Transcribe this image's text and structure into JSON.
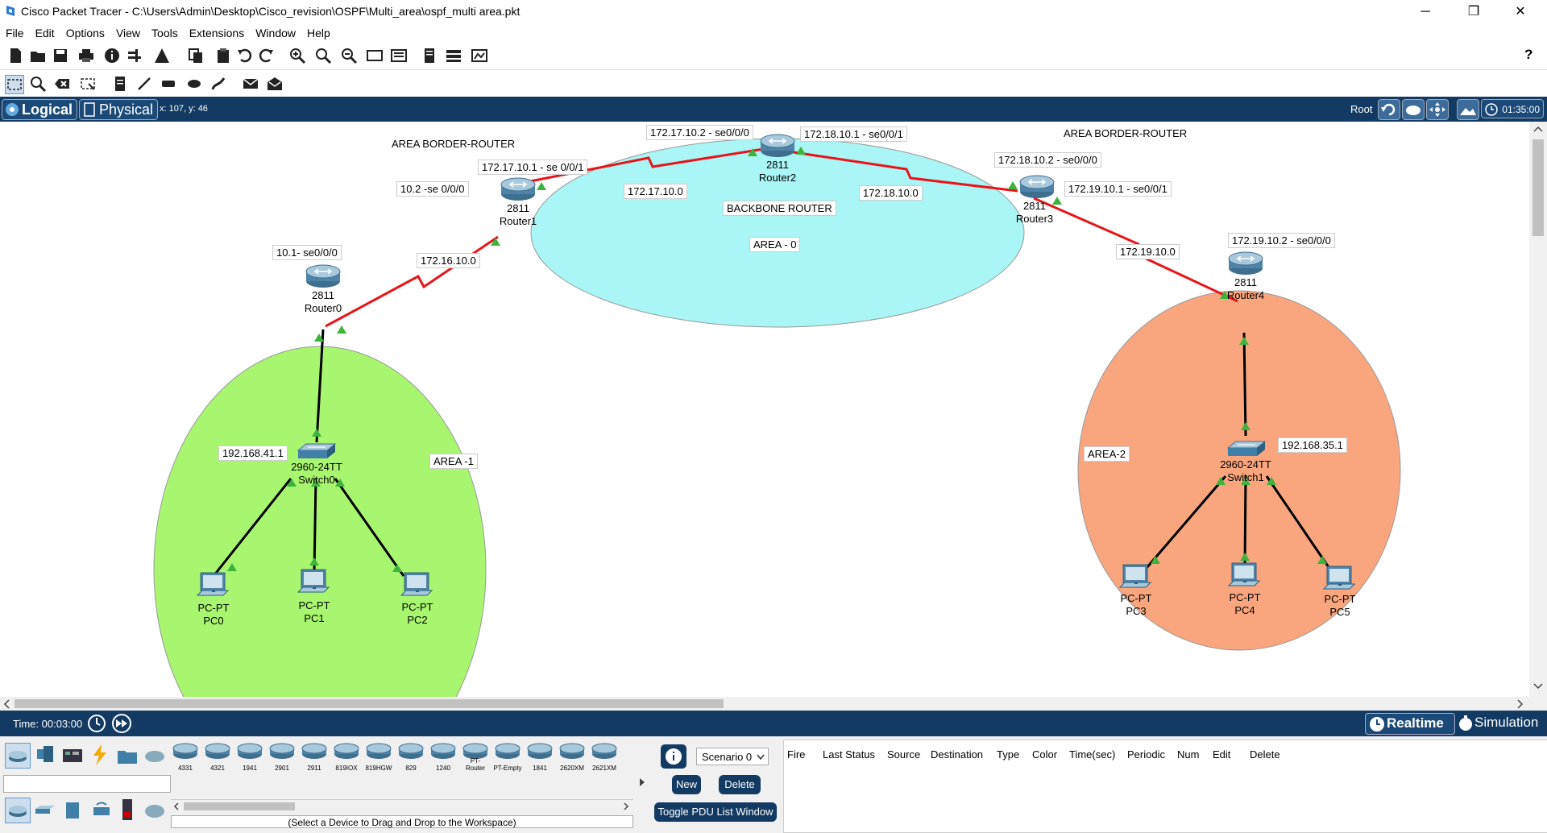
{
  "window": {
    "title": "Cisco Packet Tracer - C:\\Users\\Admin\\Desktop\\Cisco_revision\\OSPF\\Multi_area\\ospf_multi area.pkt",
    "minimize": "─",
    "restore": "❐",
    "close": "✕"
  },
  "menu": [
    "File",
    "Edit",
    "Options",
    "View",
    "Tools",
    "Extensions",
    "Window",
    "Help"
  ],
  "toolbar": {
    "help": "?",
    "main_icons": [
      "new-icon",
      "open-icon",
      "save-icon",
      "print-icon",
      "info-icon",
      "wizard-icon",
      "activity-icon",
      "copy-icon",
      "paste-icon",
      "undo-icon",
      "redo-icon",
      "zoom-in-icon",
      "zoom-reset-icon",
      "zoom-out-icon",
      "drawing-palette-icon",
      "custom-devices-icon",
      "notes-icon",
      "cluster-icon",
      "viewport-icon"
    ],
    "tool_icons": [
      "select-icon",
      "inspect-icon",
      "delete-icon",
      "resize-icon",
      "note-icon",
      "line-icon",
      "rectangle-icon",
      "ellipse-icon",
      "freeform-icon",
      "simple-pdu-icon",
      "complex-pdu-icon"
    ]
  },
  "modebar": {
    "logical": "Logical",
    "physical": "Physical",
    "coords": "x: 107, y: 46",
    "root": "Root",
    "time": "01:35:00"
  },
  "topology": {
    "areas": {
      "backbone": {
        "label": "AREA - 0",
        "sublabel": "BACKBONE ROUTER",
        "color": "#aaf5f5"
      },
      "area1": {
        "label": "AREA -1",
        "color": "#a8f56f"
      },
      "area2": {
        "label": "AREA-2",
        "color": "#f9a67e"
      }
    },
    "annotations": {
      "abr_left": "AREA BORDER-ROUTER",
      "abr_right": "AREA BORDER-ROUTER",
      "r2_left_if": "172.17.10.2 - se0/0/0",
      "r2_right_if": "172.18.10.1 - se0/0/1",
      "r1_right_if": "172.17.10.1 - se 0/0/1",
      "r1_left_if": "10.2 -se 0/0/0",
      "r0_if": "10.1- se0/0/0",
      "net_17": "172.17.10.0",
      "net_18": "172.18.10.0",
      "net_16": "172.16.10.0",
      "r3_left_if": "172.18.10.2 - se0/0/0",
      "r3_right_if": "172.19.10.1 - se0/0/1",
      "net_19": "172.19.10.0",
      "r4_if": "172.19.10.2 - se0/0/0",
      "sw0_ip": "192.168.41.1",
      "sw1_ip": "192.168.35.1"
    },
    "devices": {
      "router0": {
        "model": "2811",
        "name": "Router0"
      },
      "router1": {
        "model": "2811",
        "name": "Router1"
      },
      "router2": {
        "model": "2811",
        "name": "Router2"
      },
      "router3": {
        "model": "2811",
        "name": "Router3"
      },
      "router4": {
        "model": "2811",
        "name": "Router4"
      },
      "switch0": {
        "model": "2960-24TT",
        "name": "Switch0"
      },
      "switch1": {
        "model": "2960-24TT",
        "name": "Switch1"
      },
      "pc0": {
        "model": "PC-PT",
        "name": "PC0"
      },
      "pc1": {
        "model": "PC-PT",
        "name": "PC1"
      },
      "pc2": {
        "model": "PC-PT",
        "name": "PC2"
      },
      "pc3": {
        "model": "PC-PT",
        "name": "PC3"
      },
      "pc4": {
        "model": "PC-PT",
        "name": "PC4"
      },
      "pc5": {
        "model": "PC-PT",
        "name": "PC5"
      }
    },
    "colors": {
      "serial_link": "#e8141a",
      "ethernet_link": "#000000",
      "link_up": "#3db33d"
    }
  },
  "status": {
    "time": "Time: 00:03:00",
    "realtime": "Realtime",
    "simulation": "Simulation"
  },
  "device_panel": {
    "models": [
      "4331",
      "4321",
      "1941",
      "2901",
      "2911",
      "819IOX",
      "819HGW",
      "829",
      "1240",
      "PT-Router",
      "PT-Empty",
      "1841",
      "2620XM",
      "2621XM"
    ],
    "hint": "(Select a Device to Drag and Drop to the Workspace)"
  },
  "pdu": {
    "scenario": "Scenario 0",
    "new": "New",
    "delete": "Delete",
    "toggle": "Toggle PDU List Window",
    "columns": [
      "Fire",
      "Last Status",
      "Source",
      "Destination",
      "Type",
      "Color",
      "Time(sec)",
      "Periodic",
      "Num",
      "Edit",
      "Delete"
    ]
  }
}
